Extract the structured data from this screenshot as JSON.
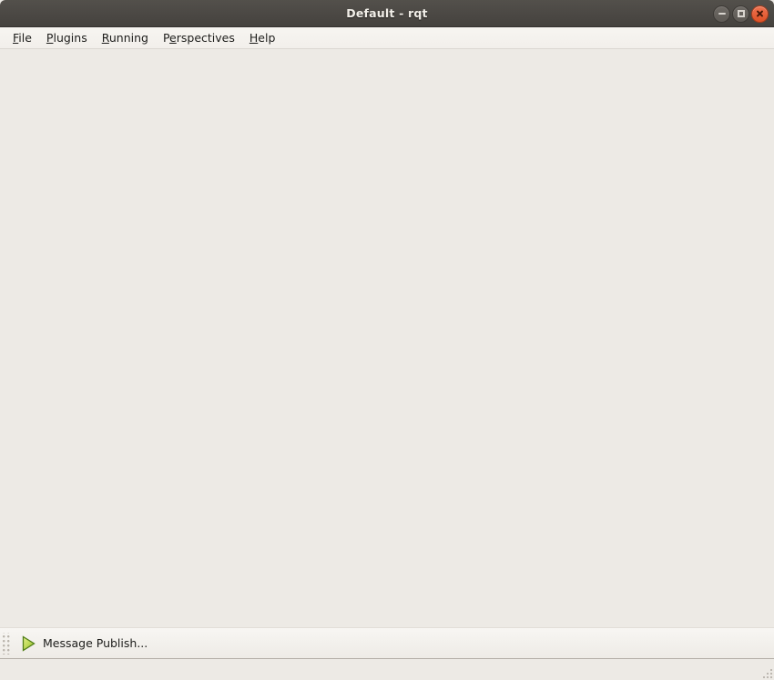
{
  "window": {
    "title": "Default - rqt",
    "controls": [
      {
        "name": "minimize",
        "icon": "minimize-icon",
        "label": "Minimize"
      },
      {
        "name": "maximize",
        "icon": "maximize-icon",
        "label": "Maximize"
      },
      {
        "name": "close",
        "icon": "close-icon",
        "label": "Close"
      }
    ],
    "close_color": "#de5126",
    "titlebar_color": "#4b4844",
    "background_color": "#edeae5"
  },
  "menubar": {
    "items": [
      {
        "label": "File",
        "pre": "",
        "mnemonic": "F",
        "post": "ile"
      },
      {
        "label": "Plugins",
        "pre": "",
        "mnemonic": "P",
        "post": "lugins"
      },
      {
        "label": "Running",
        "pre": "",
        "mnemonic": "R",
        "post": "unning"
      },
      {
        "label": "Perspectives",
        "pre": "P",
        "mnemonic": "e",
        "post": "rspectives"
      },
      {
        "label": "Help",
        "pre": "",
        "mnemonic": "H",
        "post": "elp"
      }
    ]
  },
  "central": {
    "content": ""
  },
  "toolbar": {
    "handle_icon": "drag-handle-icon",
    "buttons": [
      {
        "label": "Message Publish...",
        "icon": "play-triangle-icon",
        "icon_fill_light": "#d4e66a",
        "icon_fill_dark": "#7fb02a",
        "icon_border": "#4f7d16"
      }
    ]
  },
  "statusbar": {
    "message": "",
    "sizegrip_icon": "resize-grip-icon"
  }
}
